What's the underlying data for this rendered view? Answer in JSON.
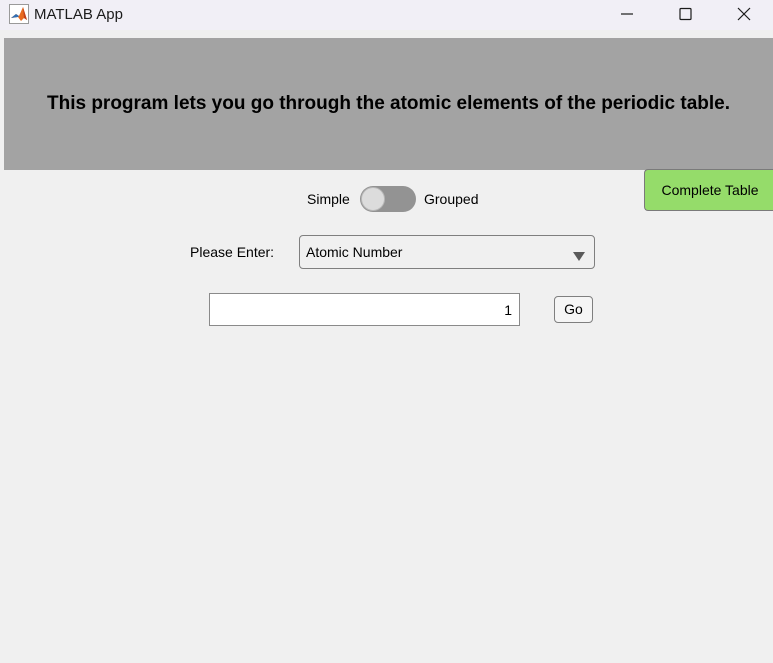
{
  "window": {
    "title": "MATLAB App",
    "minimize_icon": "minimize-icon",
    "maximize_icon": "maximize-icon",
    "close_icon": "close-icon"
  },
  "banner": {
    "text": "This program lets you go through the atomic elements of the periodic table.",
    "background_color": "#a3a3a3"
  },
  "complete_table_button": {
    "label": "Complete Table",
    "color": "#95dc6a"
  },
  "mode_switch": {
    "left_label": "Simple",
    "right_label": "Grouped",
    "state": "Simple"
  },
  "input_type": {
    "label": "Please Enter:",
    "selected": "Atomic Number"
  },
  "value_field": {
    "value": "1"
  },
  "go_button": {
    "label": "Go"
  }
}
